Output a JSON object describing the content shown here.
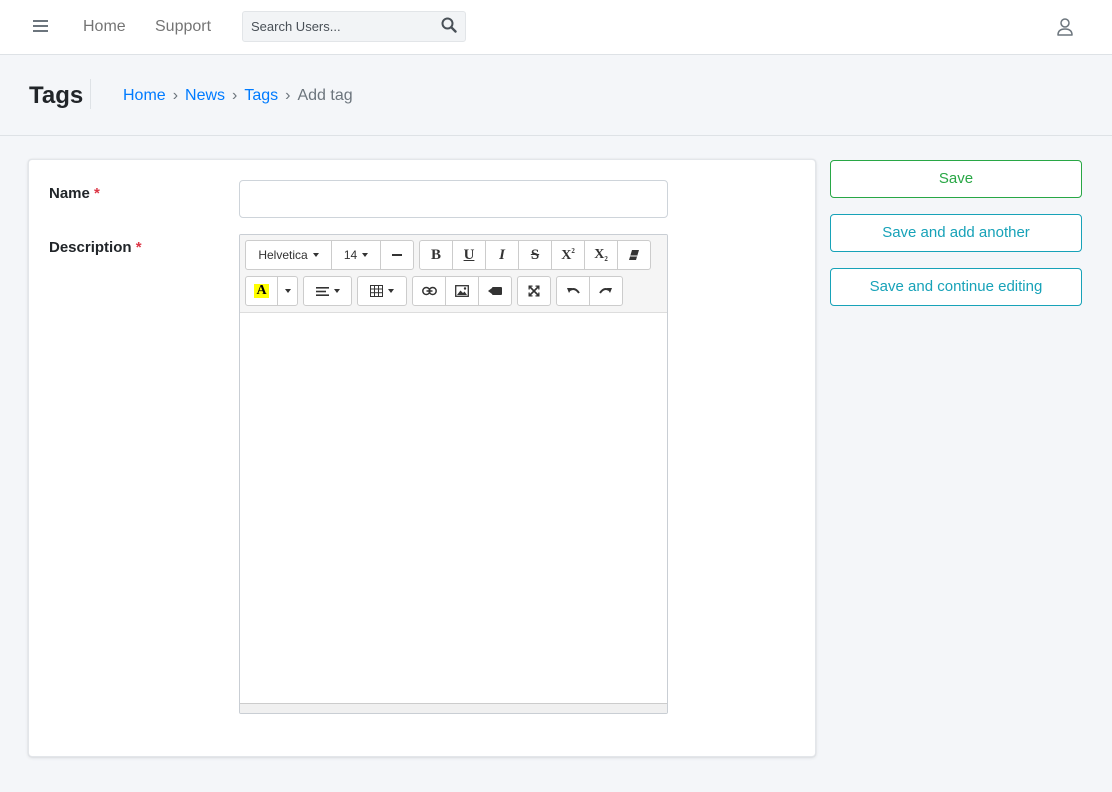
{
  "navbar": {
    "menu_icon": "bars-icon",
    "links": {
      "home": "Home",
      "support": "Support"
    },
    "search": {
      "placeholder": "Search Users...",
      "value": "",
      "icon": "search-icon"
    },
    "user_icon": "user-icon"
  },
  "header": {
    "title": "Tags",
    "breadcrumb": {
      "home": "Home",
      "news": "News",
      "tags": "Tags",
      "current": "Add tag",
      "separator": "›"
    }
  },
  "form": {
    "name_label": "Name",
    "description_label": "Description",
    "required_mark": "*",
    "name_value": ""
  },
  "editor": {
    "font_family": "Helvetica",
    "font_size": "14",
    "highlight_letter": "A",
    "bold": "B",
    "underline": "U",
    "italic": "I",
    "strikethrough": "S",
    "superscript": "X",
    "subscript": "X",
    "sup_mark": "2",
    "sub_mark": "2",
    "highlight_color": "#ffff00",
    "content": ""
  },
  "actions": {
    "save": "Save",
    "save_add": "Save and add another",
    "save_continue": "Save and continue editing",
    "save_color": "#28a745",
    "secondary_color": "#17a2b8"
  },
  "colors": {
    "link": "#007bff",
    "required": "#dc3545",
    "background": "#f4f6f9"
  }
}
